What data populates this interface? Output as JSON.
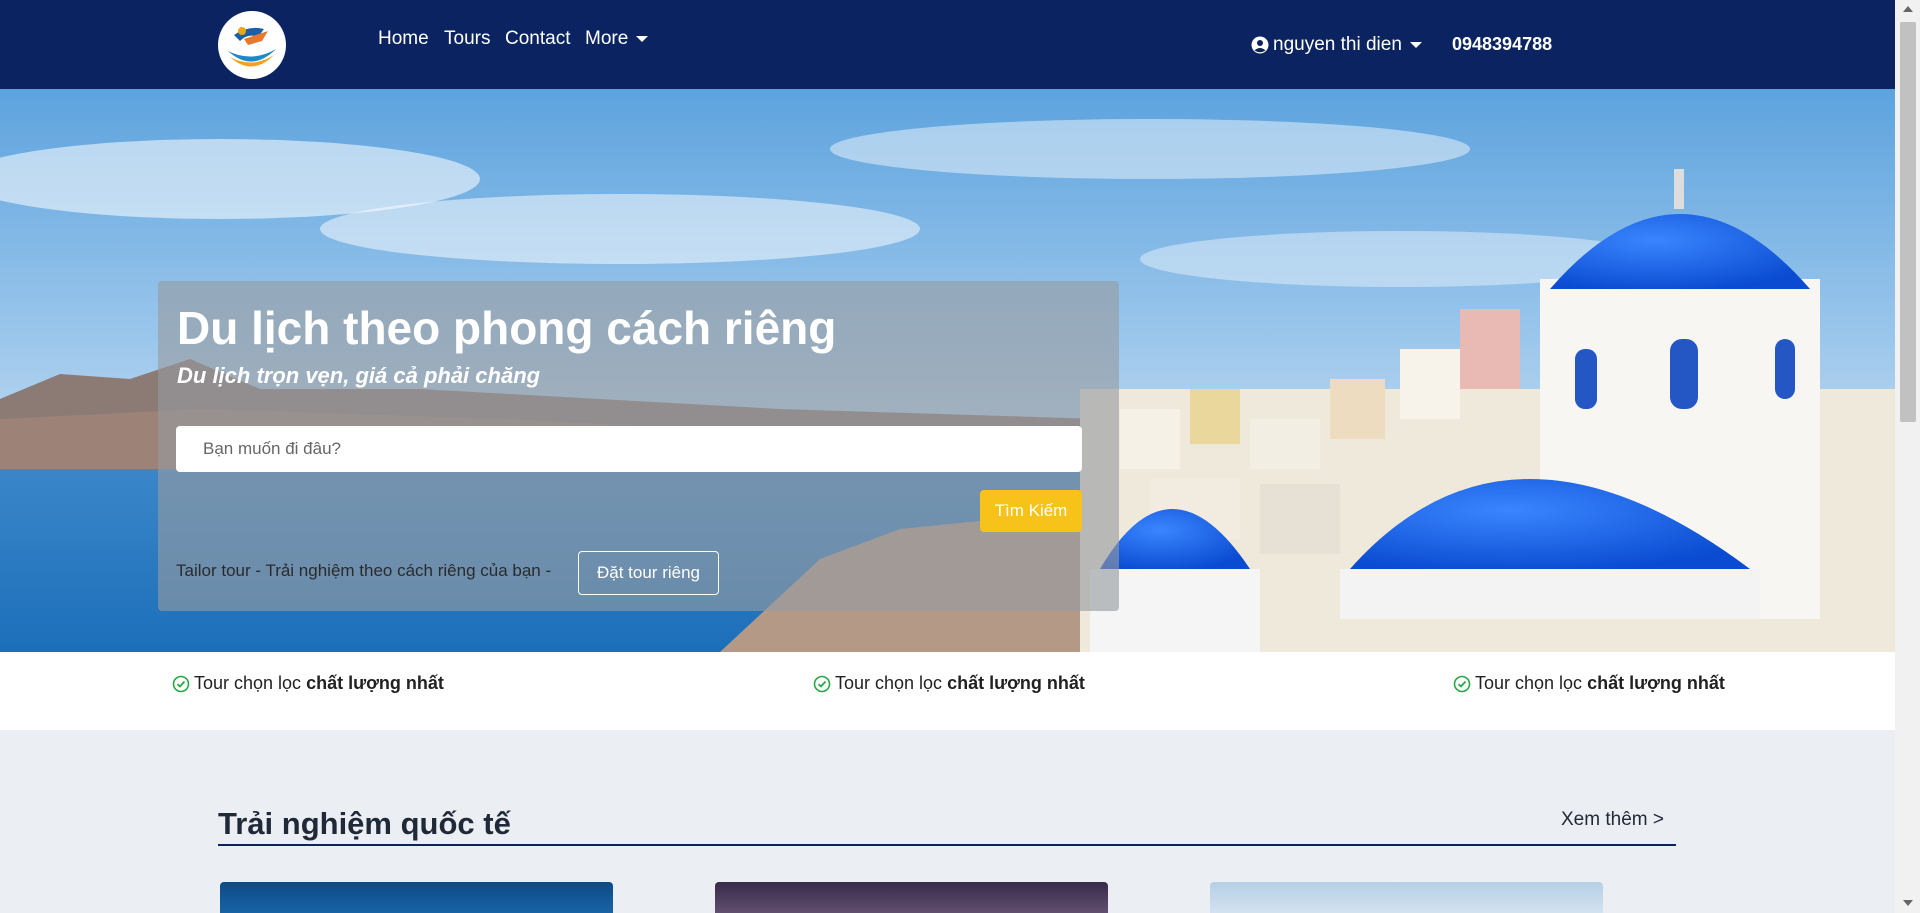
{
  "nav": {
    "links": [
      "Home",
      "Tours",
      "Contact",
      "More"
    ],
    "user_name": "nguyen thi dien",
    "phone": "0948394788"
  },
  "hero": {
    "title": "Du lịch theo phong cách riêng",
    "subtitle": "Du lịch trọn vẹn, giá cả phải chăng",
    "search_placeholder": "Bạn muốn đi đâu?",
    "search_button": "Tìm Kiếm",
    "tailor_text": "Tailor tour - Trải nghiệm theo cách riêng của bạn -",
    "tailor_button": "Đặt tour riêng"
  },
  "features": [
    {
      "prefix": "Tour chọn lọc",
      "bold": "chất lượng nhất"
    },
    {
      "prefix": "Tour chọn lọc",
      "bold": "chất lượng nhất"
    },
    {
      "prefix": "Tour chọn lọc",
      "bold": "chất lượng nhất"
    }
  ],
  "section": {
    "title": "Trải nghiệm quốc tế",
    "see_more": "Xem thêm >"
  },
  "colors": {
    "navbar": "#0b2461",
    "accent": "#f7c21a",
    "check": "#28a745",
    "page_bg": "#ebeef3"
  },
  "icons": {
    "user": "user-circle-icon",
    "check": "check-circle-icon",
    "caret": "caret-down-icon"
  }
}
